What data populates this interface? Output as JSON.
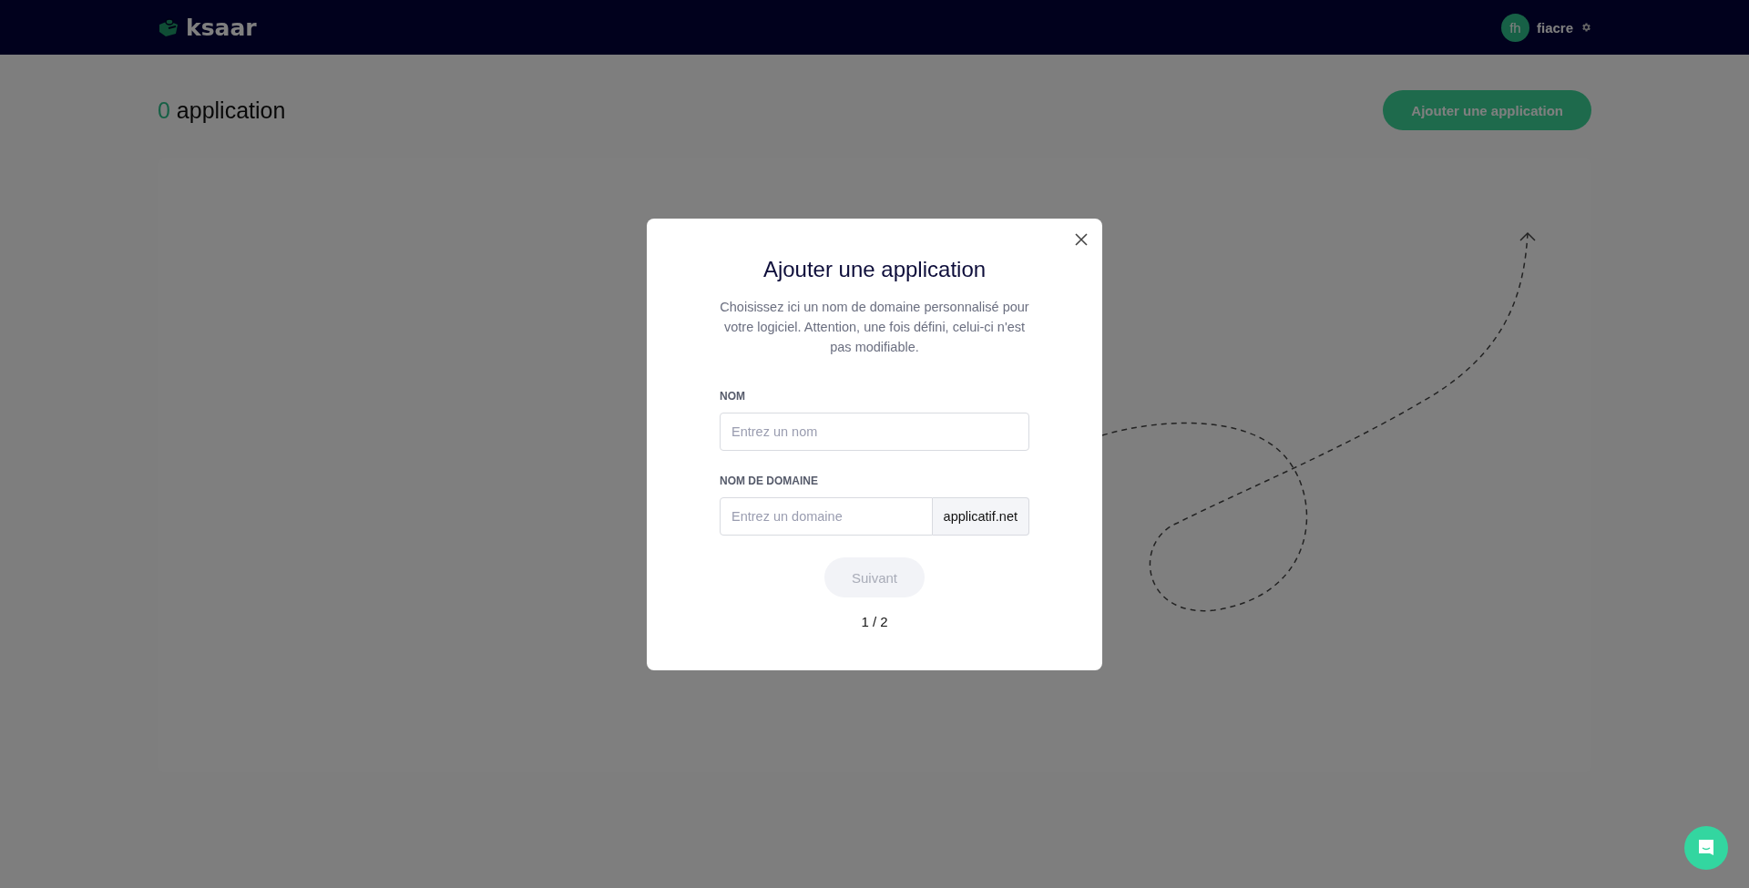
{
  "header": {
    "logo": "ksaar",
    "user": {
      "initials": "fh",
      "name": "fiacre"
    }
  },
  "page": {
    "count": "0",
    "title": "application",
    "add_button": "Ajouter une application"
  },
  "modal": {
    "title": "Ajouter une application",
    "description": "Choisissez ici un nom de domaine personnalisé pour votre logiciel. Attention, une fois défini, celui-ci n'est pas modifiable.",
    "fields": [
      {
        "kind": "text",
        "label": "NOM",
        "placeholder": "Entrez un nom"
      },
      {
        "kind": "suffixed",
        "label": "NOM DE DOMAINE",
        "placeholder": "Entrez un domaine",
        "suffix": "applicatif.net"
      }
    ],
    "next_button": {
      "label": "Suivant",
      "disabled": true
    },
    "step": "1 / 2"
  }
}
